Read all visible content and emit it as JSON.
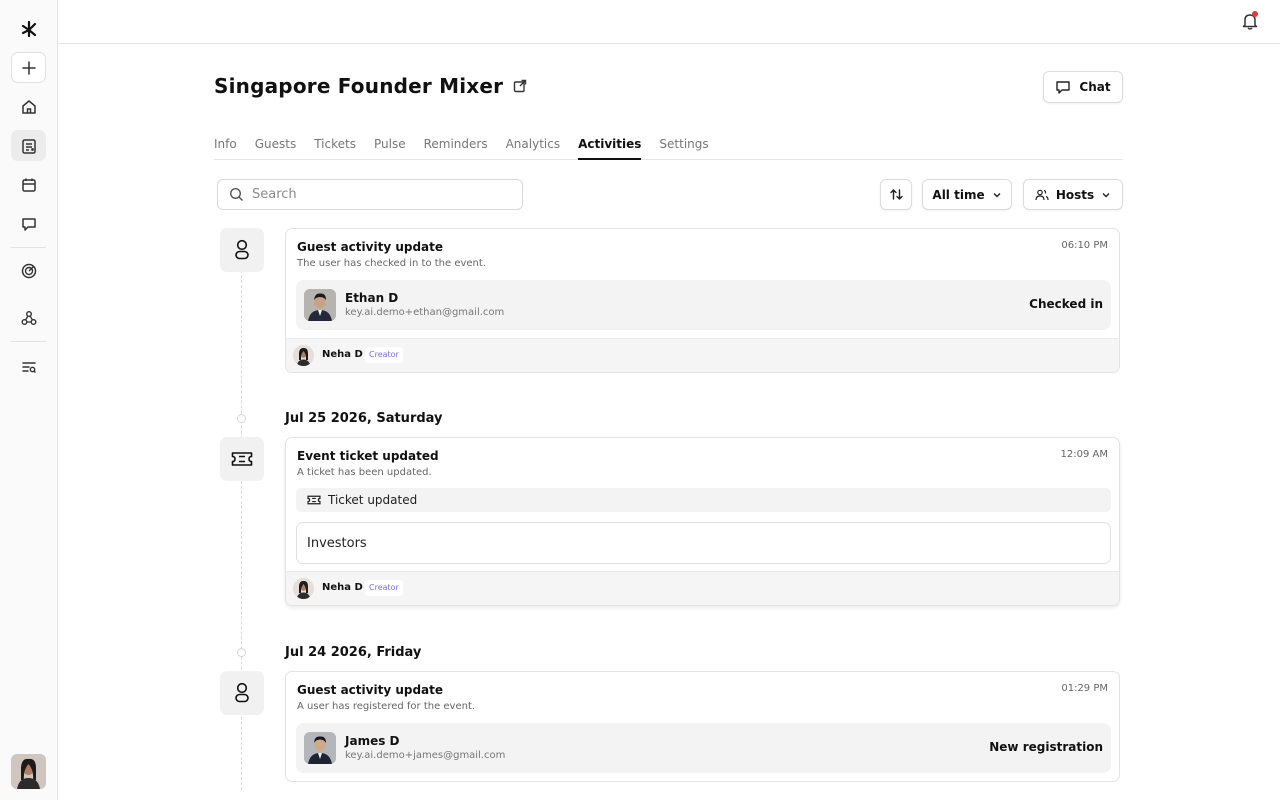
{
  "app": {
    "logo_icon": "brand-logo-icon"
  },
  "sidebar": {
    "items": [
      {
        "icon": "plus-icon",
        "label": "New"
      },
      {
        "icon": "home-icon",
        "label": "Home"
      },
      {
        "icon": "events-icon",
        "label": "Events"
      },
      {
        "icon": "calendar-icon",
        "label": "Calendar"
      },
      {
        "icon": "chat-icon",
        "label": "Messages"
      },
      {
        "icon": "target-icon",
        "label": "Targets"
      },
      {
        "icon": "webhook-icon",
        "label": "Integrations"
      },
      {
        "icon": "list-search-icon",
        "label": "Search"
      }
    ]
  },
  "event": {
    "title": "Singapore Founder Mixer"
  },
  "header": {
    "chat_label": "Chat"
  },
  "tabs": [
    {
      "label": "Info",
      "active": false
    },
    {
      "label": "Guests",
      "active": false
    },
    {
      "label": "Tickets",
      "active": false
    },
    {
      "label": "Pulse",
      "active": false
    },
    {
      "label": "Reminders",
      "active": false
    },
    {
      "label": "Analytics",
      "active": false
    },
    {
      "label": "Activities",
      "active": true
    },
    {
      "label": "Settings",
      "active": false
    }
  ],
  "toolbar": {
    "search_placeholder": "Search",
    "time_filter": "All time",
    "host_filter": "Hosts"
  },
  "activities": {
    "first": {
      "title": "Guest activity update",
      "subtitle": "The user has checked in to the event.",
      "time": "06:10 PM",
      "person_name": "Ethan D",
      "person_email": "key.ai.demo+ethan@gmail.com",
      "status": "Checked in",
      "actor_name": "Neha D",
      "actor_role": "Creator"
    },
    "date2": "Jul 25 2026, Saturday",
    "second": {
      "title": "Event ticket updated",
      "subtitle": "A ticket has been updated.",
      "time": "12:09 AM",
      "change_label": "Ticket updated",
      "ticket_name": "Investors",
      "actor_name": "Neha D",
      "actor_role": "Creator"
    },
    "date3": "Jul 24 2026, Friday",
    "third": {
      "title": "Guest activity update",
      "subtitle": "A user has registered for the event.",
      "time": "01:29 PM",
      "person_name": "James D",
      "person_email": "key.ai.demo+james@gmail.com",
      "status": "New registration"
    }
  },
  "colors": {
    "accent_badge": "#7b6cf0",
    "notification_dot": "#e53935"
  }
}
